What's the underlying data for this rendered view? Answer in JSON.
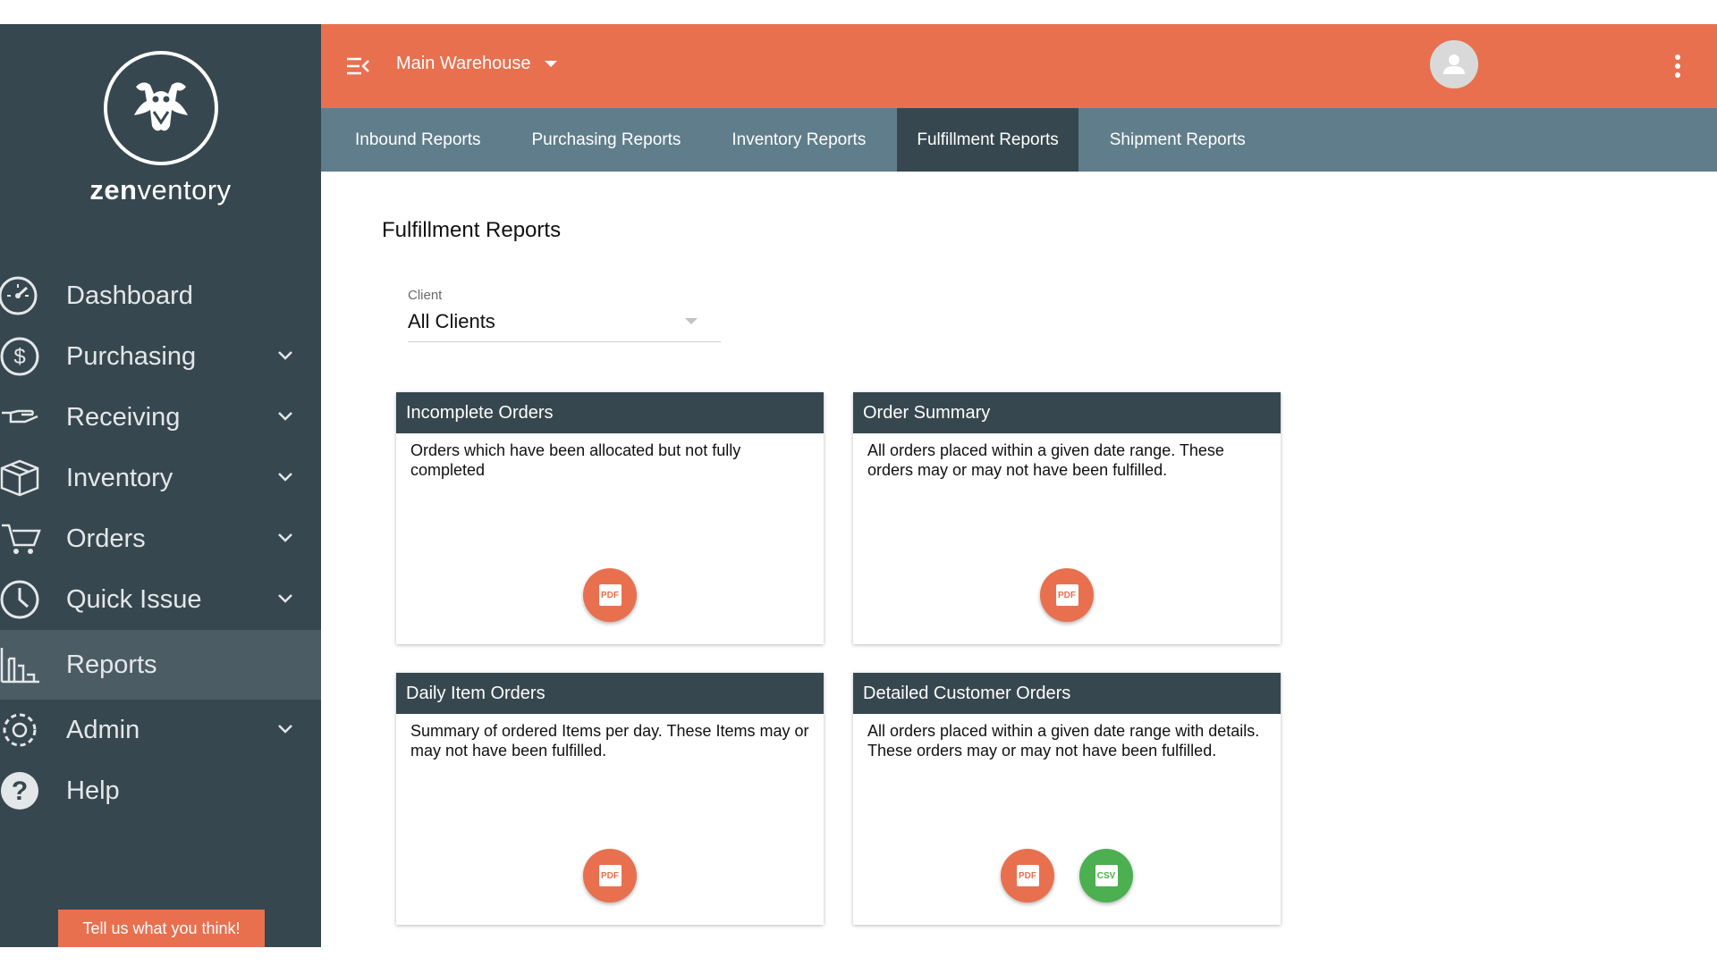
{
  "brand": {
    "name_bold": "zen",
    "name_rest": "ventory"
  },
  "sidebar": {
    "items": [
      {
        "label": "Dashboard",
        "icon": "dashboard-gauge-icon",
        "expandable": false,
        "active": false
      },
      {
        "label": "Purchasing",
        "icon": "dollar-icon",
        "expandable": true,
        "active": false
      },
      {
        "label": "Receiving",
        "icon": "hand-receive-icon",
        "expandable": true,
        "active": false
      },
      {
        "label": "Inventory",
        "icon": "box-icon",
        "expandable": true,
        "active": false
      },
      {
        "label": "Orders",
        "icon": "cart-icon",
        "expandable": true,
        "active": false
      },
      {
        "label": "Quick Issue",
        "icon": "clock-icon",
        "expandable": true,
        "active": false
      },
      {
        "label": "Reports",
        "icon": "bar-chart-icon",
        "expandable": false,
        "active": true
      },
      {
        "label": "Admin",
        "icon": "gear-icon",
        "expandable": true,
        "active": false
      },
      {
        "label": "Help",
        "icon": "help-icon",
        "expandable": false,
        "active": false
      }
    ],
    "feedback_label": "Tell us what you think!"
  },
  "topbar": {
    "warehouse": "Main Warehouse"
  },
  "tabs": [
    {
      "label": "Inbound Reports",
      "active": false
    },
    {
      "label": "Purchasing Reports",
      "active": false
    },
    {
      "label": "Inventory Reports",
      "active": false
    },
    {
      "label": "Fulfillment Reports",
      "active": true
    },
    {
      "label": "Shipment Reports",
      "active": false
    }
  ],
  "page": {
    "title": "Fulfillment Reports",
    "client_label": "Client",
    "client_value": "All Clients"
  },
  "reports": [
    {
      "title": "Incomplete Orders",
      "description": "Orders which have been allocated but not fully completed",
      "formats": [
        "PDF"
      ]
    },
    {
      "title": "Order Summary",
      "description": "All orders placed within a given date range. These orders may or may not have been fulfilled.",
      "formats": [
        "PDF"
      ]
    },
    {
      "title": "Daily Item Orders",
      "description": "Summary of ordered Items per day. These Items may or may not have been fulfilled.",
      "formats": [
        "PDF"
      ]
    },
    {
      "title": "Detailed Customer Orders",
      "description": "All orders placed within a given date range with details. These orders may or may not have been fulfilled.",
      "formats": [
        "PDF",
        "CSV"
      ]
    }
  ],
  "colors": {
    "accent": "#e8704f",
    "sidebar": "#37474f",
    "tabbar": "#607d8b",
    "csv": "#4caf50"
  }
}
